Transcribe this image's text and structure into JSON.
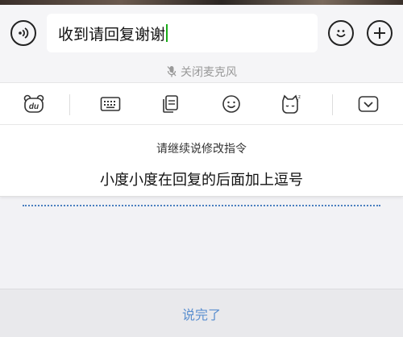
{
  "input": {
    "text": "收到请回复谢谢"
  },
  "mic": {
    "label": "关闭麦克风"
  },
  "toolbar": {
    "items": [
      "du-bear-icon",
      "keyboard-icon",
      "copy-icon",
      "emoji-icon",
      "cat-sleep-icon",
      "chevron-down-icon"
    ]
  },
  "panel": {
    "hint": "请继续说修改指令",
    "command": "小度小度在回复的后面加上逗号"
  },
  "done": {
    "label": "说完了"
  },
  "colors": {
    "cursor": "#1aad19",
    "done_text": "#5b8fcf",
    "wave": "#4a7fbf"
  }
}
